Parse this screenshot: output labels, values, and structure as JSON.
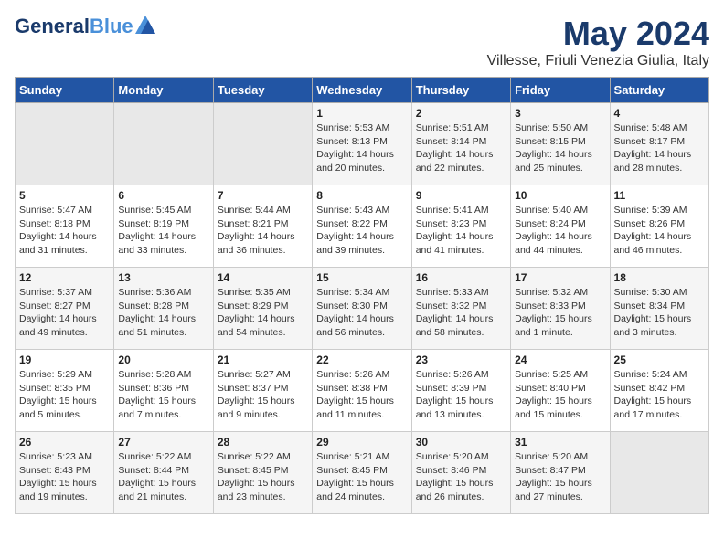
{
  "header": {
    "logo_general": "General",
    "logo_blue": "Blue",
    "month_year": "May 2024",
    "location": "Villesse, Friuli Venezia Giulia, Italy"
  },
  "days_of_week": [
    "Sunday",
    "Monday",
    "Tuesday",
    "Wednesday",
    "Thursday",
    "Friday",
    "Saturday"
  ],
  "weeks": [
    [
      {
        "day": "",
        "info": ""
      },
      {
        "day": "",
        "info": ""
      },
      {
        "day": "",
        "info": ""
      },
      {
        "day": "1",
        "info": "Sunrise: 5:53 AM\nSunset: 8:13 PM\nDaylight: 14 hours\nand 20 minutes."
      },
      {
        "day": "2",
        "info": "Sunrise: 5:51 AM\nSunset: 8:14 PM\nDaylight: 14 hours\nand 22 minutes."
      },
      {
        "day": "3",
        "info": "Sunrise: 5:50 AM\nSunset: 8:15 PM\nDaylight: 14 hours\nand 25 minutes."
      },
      {
        "day": "4",
        "info": "Sunrise: 5:48 AM\nSunset: 8:17 PM\nDaylight: 14 hours\nand 28 minutes."
      }
    ],
    [
      {
        "day": "5",
        "info": "Sunrise: 5:47 AM\nSunset: 8:18 PM\nDaylight: 14 hours\nand 31 minutes."
      },
      {
        "day": "6",
        "info": "Sunrise: 5:45 AM\nSunset: 8:19 PM\nDaylight: 14 hours\nand 33 minutes."
      },
      {
        "day": "7",
        "info": "Sunrise: 5:44 AM\nSunset: 8:21 PM\nDaylight: 14 hours\nand 36 minutes."
      },
      {
        "day": "8",
        "info": "Sunrise: 5:43 AM\nSunset: 8:22 PM\nDaylight: 14 hours\nand 39 minutes."
      },
      {
        "day": "9",
        "info": "Sunrise: 5:41 AM\nSunset: 8:23 PM\nDaylight: 14 hours\nand 41 minutes."
      },
      {
        "day": "10",
        "info": "Sunrise: 5:40 AM\nSunset: 8:24 PM\nDaylight: 14 hours\nand 44 minutes."
      },
      {
        "day": "11",
        "info": "Sunrise: 5:39 AM\nSunset: 8:26 PM\nDaylight: 14 hours\nand 46 minutes."
      }
    ],
    [
      {
        "day": "12",
        "info": "Sunrise: 5:37 AM\nSunset: 8:27 PM\nDaylight: 14 hours\nand 49 minutes."
      },
      {
        "day": "13",
        "info": "Sunrise: 5:36 AM\nSunset: 8:28 PM\nDaylight: 14 hours\nand 51 minutes."
      },
      {
        "day": "14",
        "info": "Sunrise: 5:35 AM\nSunset: 8:29 PM\nDaylight: 14 hours\nand 54 minutes."
      },
      {
        "day": "15",
        "info": "Sunrise: 5:34 AM\nSunset: 8:30 PM\nDaylight: 14 hours\nand 56 minutes."
      },
      {
        "day": "16",
        "info": "Sunrise: 5:33 AM\nSunset: 8:32 PM\nDaylight: 14 hours\nand 58 minutes."
      },
      {
        "day": "17",
        "info": "Sunrise: 5:32 AM\nSunset: 8:33 PM\nDaylight: 15 hours\nand 1 minute."
      },
      {
        "day": "18",
        "info": "Sunrise: 5:30 AM\nSunset: 8:34 PM\nDaylight: 15 hours\nand 3 minutes."
      }
    ],
    [
      {
        "day": "19",
        "info": "Sunrise: 5:29 AM\nSunset: 8:35 PM\nDaylight: 15 hours\nand 5 minutes."
      },
      {
        "day": "20",
        "info": "Sunrise: 5:28 AM\nSunset: 8:36 PM\nDaylight: 15 hours\nand 7 minutes."
      },
      {
        "day": "21",
        "info": "Sunrise: 5:27 AM\nSunset: 8:37 PM\nDaylight: 15 hours\nand 9 minutes."
      },
      {
        "day": "22",
        "info": "Sunrise: 5:26 AM\nSunset: 8:38 PM\nDaylight: 15 hours\nand 11 minutes."
      },
      {
        "day": "23",
        "info": "Sunrise: 5:26 AM\nSunset: 8:39 PM\nDaylight: 15 hours\nand 13 minutes."
      },
      {
        "day": "24",
        "info": "Sunrise: 5:25 AM\nSunset: 8:40 PM\nDaylight: 15 hours\nand 15 minutes."
      },
      {
        "day": "25",
        "info": "Sunrise: 5:24 AM\nSunset: 8:42 PM\nDaylight: 15 hours\nand 17 minutes."
      }
    ],
    [
      {
        "day": "26",
        "info": "Sunrise: 5:23 AM\nSunset: 8:43 PM\nDaylight: 15 hours\nand 19 minutes."
      },
      {
        "day": "27",
        "info": "Sunrise: 5:22 AM\nSunset: 8:44 PM\nDaylight: 15 hours\nand 21 minutes."
      },
      {
        "day": "28",
        "info": "Sunrise: 5:22 AM\nSunset: 8:45 PM\nDaylight: 15 hours\nand 23 minutes."
      },
      {
        "day": "29",
        "info": "Sunrise: 5:21 AM\nSunset: 8:45 PM\nDaylight: 15 hours\nand 24 minutes."
      },
      {
        "day": "30",
        "info": "Sunrise: 5:20 AM\nSunset: 8:46 PM\nDaylight: 15 hours\nand 26 minutes."
      },
      {
        "day": "31",
        "info": "Sunrise: 5:20 AM\nSunset: 8:47 PM\nDaylight: 15 hours\nand 27 minutes."
      },
      {
        "day": "",
        "info": ""
      }
    ]
  ]
}
